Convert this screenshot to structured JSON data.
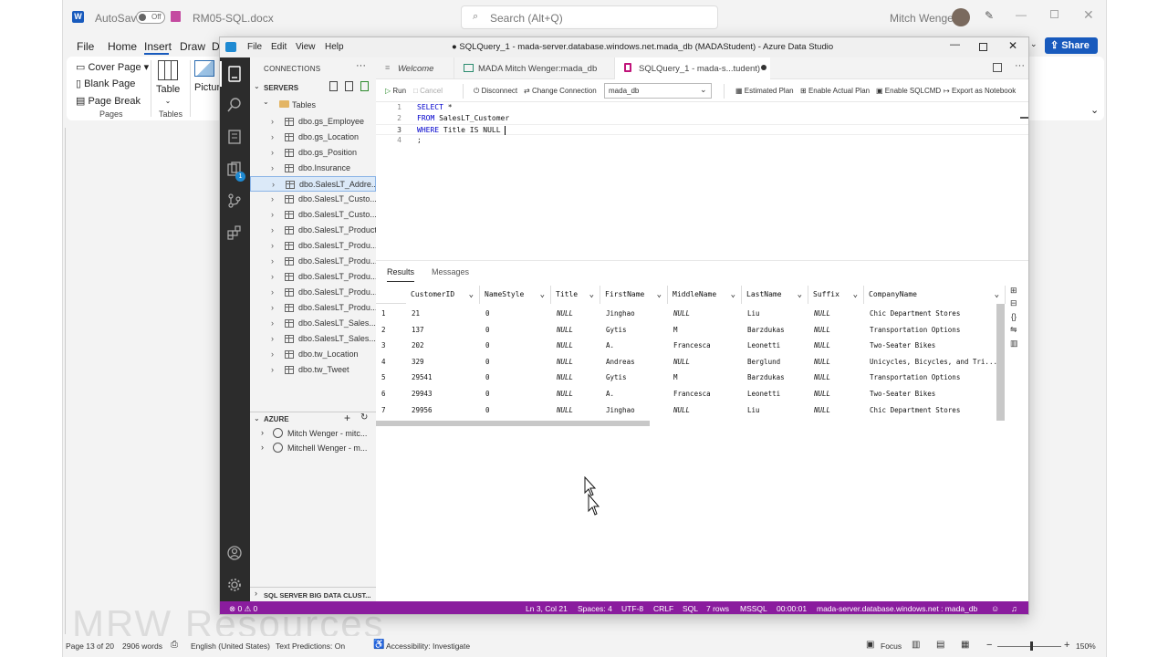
{
  "word": {
    "autosave_label": "AutoSave",
    "autosave_state": "Off",
    "doc_name": "RM05-SQL.docx",
    "search_placeholder": "Search (Alt+Q)",
    "user_name": "Mitch Wenger",
    "menu": [
      "File",
      "Home",
      "Insert",
      "Draw",
      "Di"
    ],
    "share_label": "Share",
    "ribbon": {
      "cover_page": "Cover Page",
      "blank_page": "Blank Page",
      "page_break": "Page Break",
      "pages_group": "Pages",
      "table": "Table",
      "tables_group": "Tables",
      "pictures": "Picture"
    },
    "status": {
      "page": "Page 13 of 20",
      "words": "2906 words",
      "language": "English (United States)",
      "text_predictions": "Text Predictions: On",
      "accessibility": "Accessibility: Investigate",
      "focus": "Focus",
      "zoom": "150%"
    },
    "watermark": "MRW Resources"
  },
  "ads": {
    "title": "● SQLQuery_1 - mada-server.database.windows.net.mada_db (MADAStudent) - Azure Data Studio",
    "menu": [
      "File",
      "Edit",
      "View",
      "Help"
    ],
    "connections_title": "CONNECTIONS",
    "servers_label": "SERVERS",
    "azure_label": "AZURE",
    "bigdata_label": "SQL SERVER BIG DATA CLUST...",
    "tables_folder": "Tables",
    "tables": [
      "dbo.gs_Employee",
      "dbo.gs_Location",
      "dbo.gs_Position",
      "dbo.Insurance",
      "dbo.SalesLT_Addre...",
      "dbo.SalesLT_Custo...",
      "dbo.SalesLT_Custo...",
      "dbo.SalesLT_Product",
      "dbo.SalesLT_Produ...",
      "dbo.SalesLT_Produ...",
      "dbo.SalesLT_Produ...",
      "dbo.SalesLT_Produ...",
      "dbo.SalesLT_Produ...",
      "dbo.SalesLT_Sales...",
      "dbo.SalesLT_Sales...",
      "dbo.tw_Location",
      "dbo.tw_Tweet"
    ],
    "azure_accounts": [
      "Mitch Wenger - mitc...",
      "Mitchell Wenger - m..."
    ],
    "tabs": [
      "Welcome",
      "MADA Mitch Wenger:mada_db",
      "SQLQuery_1 - mada-s...tudent)"
    ],
    "toolbar": {
      "run": "Run",
      "cancel": "Cancel",
      "disconnect": "Disconnect",
      "change_connection": "Change Connection",
      "database": "mada_db",
      "estimated_plan": "Estimated Plan",
      "enable_actual_plan": "Enable Actual Plan",
      "enable_sqlcmd": "Enable SQLCMD",
      "export_notebook": "Export as Notebook"
    },
    "code": [
      {
        "n": "1",
        "kw": "SELECT",
        "rest": " *"
      },
      {
        "n": "2",
        "kw": "FROM",
        "rest": " SalesLT_Customer"
      },
      {
        "n": "3",
        "kw": "WHERE",
        "rest": " Title IS NULL"
      },
      {
        "n": "4",
        "kw": "",
        "rest": ";"
      }
    ],
    "result_tabs": [
      "Results",
      "Messages"
    ],
    "columns": [
      "CustomerID",
      "NameStyle",
      "Title",
      "FirstName",
      "MiddleName",
      "LastName",
      "Suffix",
      "CompanyName"
    ],
    "rows": [
      [
        "1",
        "21",
        "0",
        "NULL",
        "Jinghao",
        "NULL",
        "Liu",
        "NULL",
        "Chic Department Stores"
      ],
      [
        "2",
        "137",
        "0",
        "NULL",
        "Gytis",
        "M",
        "Barzdukas",
        "NULL",
        "Transportation Options"
      ],
      [
        "3",
        "202",
        "0",
        "NULL",
        "A.",
        "Francesca",
        "Leonetti",
        "NULL",
        "Two-Seater Bikes"
      ],
      [
        "4",
        "329",
        "0",
        "NULL",
        "Andreas",
        "NULL",
        "Berglund",
        "NULL",
        "Unicycles, Bicycles, and Tri..."
      ],
      [
        "5",
        "29541",
        "0",
        "NULL",
        "Gytis",
        "M",
        "Barzdukas",
        "NULL",
        "Transportation Options"
      ],
      [
        "6",
        "29943",
        "0",
        "NULL",
        "A.",
        "Francesca",
        "Leonetti",
        "NULL",
        "Two-Seater Bikes"
      ],
      [
        "7",
        "29956",
        "0",
        "NULL",
        "Jinghao",
        "NULL",
        "Liu",
        "NULL",
        "Chic Department Stores"
      ]
    ],
    "status": {
      "problems": "⊗ 0 ⚠ 0",
      "cursor": "Ln 3, Col 21",
      "spaces": "Spaces: 4",
      "encoding": "UTF-8",
      "eol": "CRLF",
      "language": "SQL",
      "rows": "7 rows",
      "provider": "MSSQL",
      "time": "00:00:01",
      "connection": "mada-server.database.windows.net : mada_db"
    },
    "badge_count": "1",
    "accent": "#8a1c9e"
  }
}
